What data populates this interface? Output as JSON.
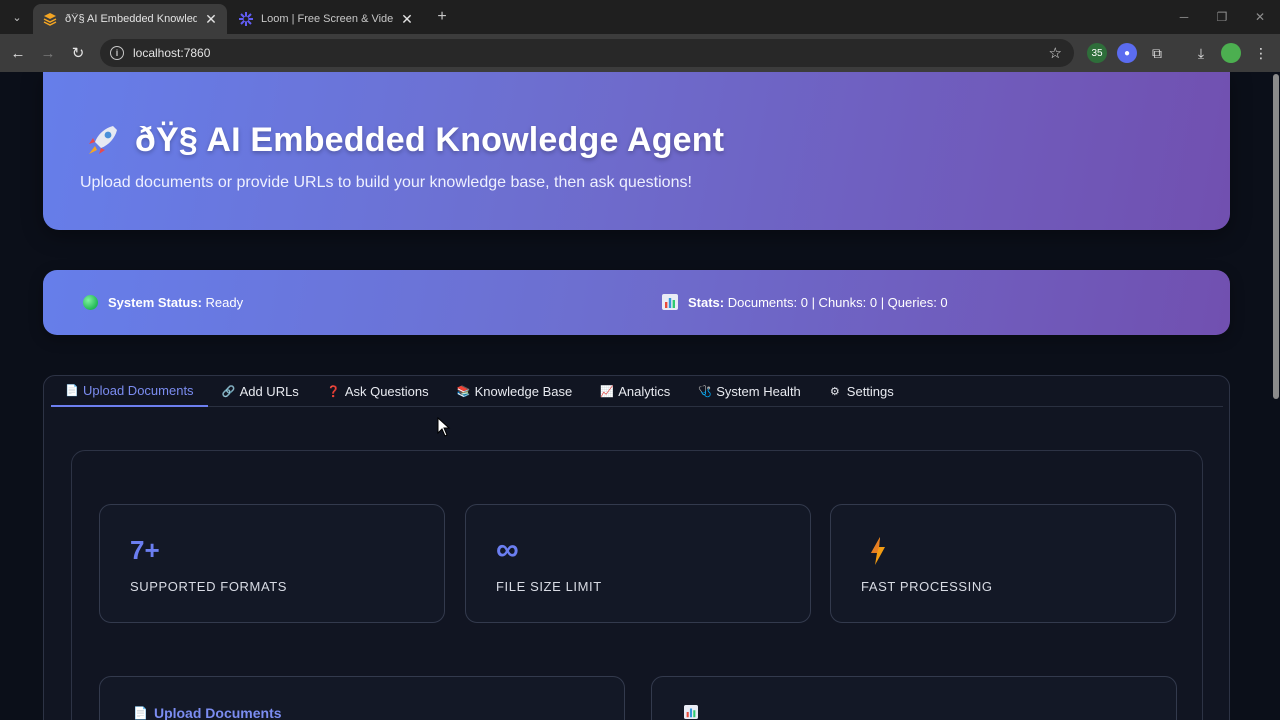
{
  "browser": {
    "tabs": [
      {
        "title": "ðŸ§  AI Embedded Knowledge A",
        "active": true
      },
      {
        "title": "Loom | Free Screen & Video Re",
        "active": false
      }
    ],
    "url": "localhost:7860",
    "extension_badge": "35"
  },
  "hero": {
    "title": "ðŸ§  AI Embedded Knowledge Agent",
    "subtitle": "Upload documents or provide URLs to build your knowledge base, then ask questions!"
  },
  "status": {
    "label": "System Status:",
    "value": "Ready",
    "stats_label": "Stats:",
    "stats_value": "Documents: 0 | Chunks: 0 | Queries: 0",
    "dot_color": "#22b856"
  },
  "tabs": [
    {
      "label": "Upload Documents",
      "icon": "📄"
    },
    {
      "label": "Add URLs",
      "icon": "🔗"
    },
    {
      "label": "Ask Questions",
      "icon": "❓"
    },
    {
      "label": "Knowledge Base",
      "icon": "📚"
    },
    {
      "label": "Analytics",
      "icon": "📈"
    },
    {
      "label": "System Health",
      "icon": "🩺"
    },
    {
      "label": "Settings",
      "icon": "⚙"
    }
  ],
  "cards": [
    {
      "value": "7+",
      "label": "SUPPORTED FORMATS"
    },
    {
      "value": "∞",
      "label": "FILE SIZE LIMIT"
    },
    {
      "value": "",
      "label": "FAST PROCESSING"
    }
  ],
  "lower": {
    "upload_title": "Upload Documents",
    "doc_icon": "📄"
  },
  "colors": {
    "accent": "#6b7ef0",
    "gradient_start": "#667eea",
    "gradient_end": "#764ba2"
  }
}
